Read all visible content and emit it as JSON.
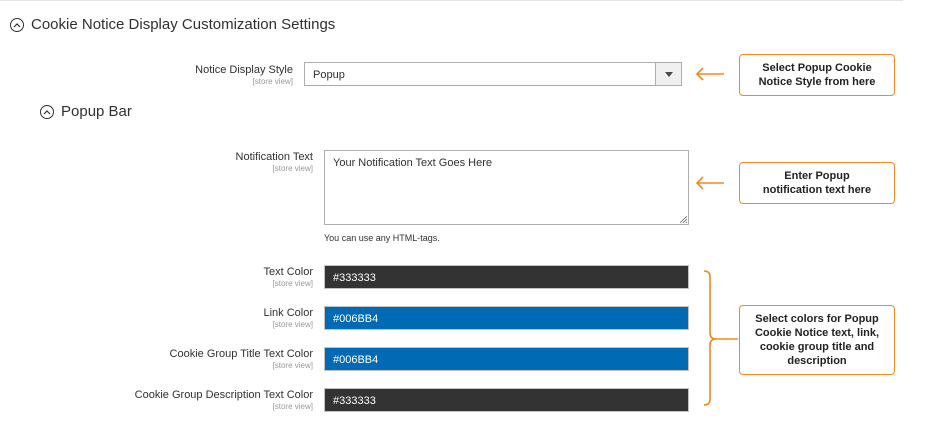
{
  "section": {
    "title": "Cookie Notice Display Customization Settings"
  },
  "notice_display_style": {
    "label": "Notice Display Style",
    "scope": "[store view]",
    "value": "Popup"
  },
  "popup_bar": {
    "title": "Popup Bar",
    "notification_text": {
      "label": "Notification Text",
      "scope": "[store view]",
      "value": "Your Notification Text Goes Here",
      "note": "You can use any HTML-tags."
    },
    "colors": [
      {
        "label": "Text Color",
        "scope": "[store view]",
        "value": "#333333",
        "swatch": "#333333"
      },
      {
        "label": "Link Color",
        "scope": "[store view]",
        "value": "#006BB4",
        "swatch": "#006BB4"
      },
      {
        "label": "Cookie Group Title Text Color",
        "scope": "[store view]",
        "value": "#006BB4",
        "swatch": "#006BB4"
      },
      {
        "label": "Cookie Group Description Text Color",
        "scope": "[store view]",
        "value": "#333333",
        "swatch": "#333333"
      }
    ]
  },
  "callouts": {
    "style": "Select Popup Cookie Notice Style from here",
    "text": "Enter Popup notification text here",
    "colors": "Select colors for Popup Cookie Notice text, link, cookie group title and description"
  },
  "accent_color": "#f08a1c"
}
